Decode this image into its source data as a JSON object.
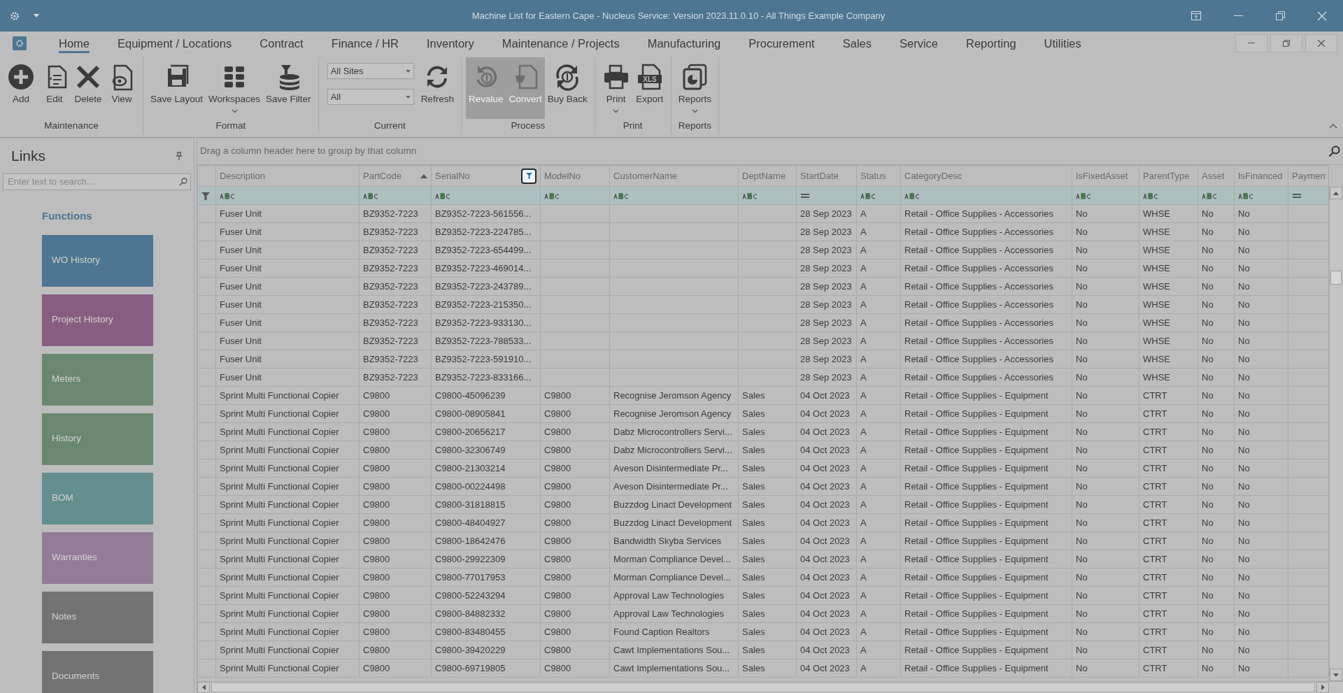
{
  "window": {
    "title": "Machine List for Eastern Cape - Nucleus Service: Version 2023.11.0.10 - All Things Example Company"
  },
  "menu_tabs": [
    {
      "label": "Home",
      "selected": true
    },
    {
      "label": "Equipment / Locations",
      "selected": false
    },
    {
      "label": "Contract",
      "selected": false
    },
    {
      "label": "Finance / HR",
      "selected": false
    },
    {
      "label": "Inventory",
      "selected": false
    },
    {
      "label": "Maintenance / Projects",
      "selected": false
    },
    {
      "label": "Manufacturing",
      "selected": false
    },
    {
      "label": "Procurement",
      "selected": false
    },
    {
      "label": "Sales",
      "selected": false
    },
    {
      "label": "Service",
      "selected": false
    },
    {
      "label": "Reporting",
      "selected": false
    },
    {
      "label": "Utilities",
      "selected": false
    }
  ],
  "ribbon_groups": [
    {
      "label": "Maintenance",
      "items": [
        {
          "kind": "button",
          "label": "Add",
          "disabled": false
        },
        {
          "kind": "button",
          "label": "Edit",
          "disabled": false
        },
        {
          "kind": "button",
          "label": "Delete",
          "disabled": false
        },
        {
          "kind": "button",
          "label": "View",
          "disabled": false
        }
      ]
    },
    {
      "label": "Format",
      "items": [
        {
          "kind": "button",
          "label": "Save Layout",
          "disabled": false
        },
        {
          "kind": "button",
          "label": "Workspaces",
          "disabled": false,
          "menu": true
        },
        {
          "kind": "button",
          "label": "Save Filter",
          "disabled": false
        }
      ]
    },
    {
      "label": "Current",
      "items": [
        {
          "kind": "dropdowns",
          "values": [
            "All Sites",
            "All"
          ]
        },
        {
          "kind": "button",
          "label": "Refresh",
          "disabled": false
        }
      ]
    },
    {
      "label": "Process",
      "items": [
        {
          "kind": "button",
          "label": "Revalue",
          "disabled": true
        },
        {
          "kind": "button",
          "label": "Convert",
          "disabled": true
        },
        {
          "kind": "button",
          "label": "Buy Back",
          "disabled": false
        }
      ]
    },
    {
      "label": "Print",
      "items": [
        {
          "kind": "button",
          "label": "Print",
          "disabled": false,
          "menu": true
        },
        {
          "kind": "button",
          "label": "Export",
          "disabled": false,
          "icon_text": "XLS"
        }
      ]
    },
    {
      "label": "Reports",
      "items": [
        {
          "kind": "button",
          "label": "Reports",
          "disabled": false,
          "menu": true
        }
      ]
    }
  ],
  "links": {
    "title": "Links",
    "search": {
      "placeholder": "Enter text to search..."
    },
    "section": "Functions",
    "tiles": [
      {
        "label": "WO History",
        "color": "#4e7591"
      },
      {
        "label": "Project History",
        "color": "#875e82"
      },
      {
        "label": "Meters",
        "color": "#6a8870"
      },
      {
        "label": "History",
        "color": "#6a8870"
      },
      {
        "label": "BOM",
        "color": "#658e8e"
      },
      {
        "label": "Warranties",
        "color": "#937c98"
      },
      {
        "label": "Notes",
        "color": "#737373"
      },
      {
        "label": "Documents",
        "color": "#737373"
      }
    ]
  },
  "grid": {
    "group_panel": "Drag a column header here to group by that column",
    "columns": [
      {
        "label": "Description"
      },
      {
        "label": "PartCode",
        "sorted_ascending": true
      },
      {
        "label": "SerialNo",
        "filter_button": true
      },
      {
        "label": "ModelNo"
      },
      {
        "label": "CustomerName"
      },
      {
        "label": "DeptName"
      },
      {
        "label": "StartDate"
      },
      {
        "label": "Status"
      },
      {
        "label": "CategoryDesc"
      },
      {
        "label": "IsFixedAsset"
      },
      {
        "label": "ParentType"
      },
      {
        "label": "Asset"
      },
      {
        "label": "IsFinanced"
      },
      {
        "label": "Paymen"
      }
    ],
    "filter_row": [
      {
        "kind": "text"
      },
      {
        "kind": "text"
      },
      {
        "kind": "text"
      },
      {
        "kind": "text"
      },
      {
        "kind": "text"
      },
      {
        "kind": "text"
      },
      {
        "kind": "equals"
      },
      {
        "kind": "text"
      },
      {
        "kind": "text"
      },
      {
        "kind": "text"
      },
      {
        "kind": "text"
      },
      {
        "kind": "text"
      },
      {
        "kind": "text"
      },
      {
        "kind": "equals"
      }
    ],
    "rows": [
      [
        "Fuser Unit",
        "BZ9352-7223",
        "BZ9352-7223-561556...",
        "",
        "",
        "",
        "28 Sep 2023",
        "A",
        "Retail - Office Supplies - Accessories",
        "No",
        "WHSE",
        "No",
        "No"
      ],
      [
        "Fuser Unit",
        "BZ9352-7223",
        "BZ9352-7223-224785...",
        "",
        "",
        "",
        "28 Sep 2023",
        "A",
        "Retail - Office Supplies - Accessories",
        "No",
        "WHSE",
        "No",
        "No"
      ],
      [
        "Fuser Unit",
        "BZ9352-7223",
        "BZ9352-7223-654499...",
        "",
        "",
        "",
        "28 Sep 2023",
        "A",
        "Retail - Office Supplies - Accessories",
        "No",
        "WHSE",
        "No",
        "No"
      ],
      [
        "Fuser Unit",
        "BZ9352-7223",
        "BZ9352-7223-469014...",
        "",
        "",
        "",
        "28 Sep 2023",
        "A",
        "Retail - Office Supplies - Accessories",
        "No",
        "WHSE",
        "No",
        "No"
      ],
      [
        "Fuser Unit",
        "BZ9352-7223",
        "BZ9352-7223-243789...",
        "",
        "",
        "",
        "28 Sep 2023",
        "A",
        "Retail - Office Supplies - Accessories",
        "No",
        "WHSE",
        "No",
        "No"
      ],
      [
        "Fuser Unit",
        "BZ9352-7223",
        "BZ9352-7223-215350...",
        "",
        "",
        "",
        "28 Sep 2023",
        "A",
        "Retail - Office Supplies - Accessories",
        "No",
        "WHSE",
        "No",
        "No"
      ],
      [
        "Fuser Unit",
        "BZ9352-7223",
        "BZ9352-7223-933130...",
        "",
        "",
        "",
        "28 Sep 2023",
        "A",
        "Retail - Office Supplies - Accessories",
        "No",
        "WHSE",
        "No",
        "No"
      ],
      [
        "Fuser Unit",
        "BZ9352-7223",
        "BZ9352-7223-788533...",
        "",
        "",
        "",
        "28 Sep 2023",
        "A",
        "Retail - Office Supplies - Accessories",
        "No",
        "WHSE",
        "No",
        "No"
      ],
      [
        "Fuser Unit",
        "BZ9352-7223",
        "BZ9352-7223-591910...",
        "",
        "",
        "",
        "28 Sep 2023",
        "A",
        "Retail - Office Supplies - Accessories",
        "No",
        "WHSE",
        "No",
        "No"
      ],
      [
        "Fuser Unit",
        "BZ9352-7223",
        "BZ9352-7223-833166...",
        "",
        "",
        "",
        "28 Sep 2023",
        "A",
        "Retail - Office Supplies - Accessories",
        "No",
        "WHSE",
        "No",
        "No"
      ],
      [
        "Sprint Multi Functional Copier",
        "C9800",
        "C9800-45096239",
        "C9800",
        "Recognise Jeromson Agency",
        "Sales",
        "04 Oct 2023",
        "A",
        "Retail - Office Supplies - Equipment",
        "No",
        "CTRT",
        "No",
        "No"
      ],
      [
        "Sprint Multi Functional Copier",
        "C9800",
        "C9800-08905841",
        "C9800",
        "Recognise Jeromson Agency",
        "Sales",
        "04 Oct 2023",
        "A",
        "Retail - Office Supplies - Equipment",
        "No",
        "CTRT",
        "No",
        "No"
      ],
      [
        "Sprint Multi Functional Copier",
        "C9800",
        "C9800-20656217",
        "C9800",
        "Dabz Microcontrollers Servi...",
        "Sales",
        "04 Oct 2023",
        "A",
        "Retail - Office Supplies - Equipment",
        "No",
        "CTRT",
        "No",
        "No"
      ],
      [
        "Sprint Multi Functional Copier",
        "C9800",
        "C9800-32306749",
        "C9800",
        "Dabz Microcontrollers Servi...",
        "Sales",
        "04 Oct 2023",
        "A",
        "Retail - Office Supplies - Equipment",
        "No",
        "CTRT",
        "No",
        "No"
      ],
      [
        "Sprint Multi Functional Copier",
        "C9800",
        "C9800-21303214",
        "C9800",
        "Aveson Disintermediate Pr...",
        "Sales",
        "04 Oct 2023",
        "A",
        "Retail - Office Supplies - Equipment",
        "No",
        "CTRT",
        "No",
        "No"
      ],
      [
        "Sprint Multi Functional Copier",
        "C9800",
        "C9800-00224498",
        "C9800",
        "Aveson Disintermediate Pr...",
        "Sales",
        "04 Oct 2023",
        "A",
        "Retail - Office Supplies - Equipment",
        "No",
        "CTRT",
        "No",
        "No"
      ],
      [
        "Sprint Multi Functional Copier",
        "C9800",
        "C9800-31818815",
        "C9800",
        "Buzzdog Linact Development",
        "Sales",
        "04 Oct 2023",
        "A",
        "Retail - Office Supplies - Equipment",
        "No",
        "CTRT",
        "No",
        "No"
      ],
      [
        "Sprint Multi Functional Copier",
        "C9800",
        "C9800-48404927",
        "C9800",
        "Buzzdog Linact Development",
        "Sales",
        "04 Oct 2023",
        "A",
        "Retail - Office Supplies - Equipment",
        "No",
        "CTRT",
        "No",
        "No"
      ],
      [
        "Sprint Multi Functional Copier",
        "C9800",
        "C9800-18642476",
        "C9800",
        "Bandwidth Skyba Services",
        "Sales",
        "04 Oct 2023",
        "A",
        "Retail - Office Supplies - Equipment",
        "No",
        "CTRT",
        "No",
        "No"
      ],
      [
        "Sprint Multi Functional Copier",
        "C9800",
        "C9800-29922309",
        "C9800",
        "Morman Compliance Devel...",
        "Sales",
        "04 Oct 2023",
        "A",
        "Retail - Office Supplies - Equipment",
        "No",
        "CTRT",
        "No",
        "No"
      ],
      [
        "Sprint Multi Functional Copier",
        "C9800",
        "C9800-77017953",
        "C9800",
        "Morman Compliance Devel...",
        "Sales",
        "04 Oct 2023",
        "A",
        "Retail - Office Supplies - Equipment",
        "No",
        "CTRT",
        "No",
        "No"
      ],
      [
        "Sprint Multi Functional Copier",
        "C9800",
        "C9800-52243294",
        "C9800",
        "Approval Law Technologies",
        "Sales",
        "04 Oct 2023",
        "A",
        "Retail - Office Supplies - Equipment",
        "No",
        "CTRT",
        "No",
        "No"
      ],
      [
        "Sprint Multi Functional Copier",
        "C9800",
        "C9800-84882332",
        "C9800",
        "Approval Law Technologies",
        "Sales",
        "04 Oct 2023",
        "A",
        "Retail - Office Supplies - Equipment",
        "No",
        "CTRT",
        "No",
        "No"
      ],
      [
        "Sprint Multi Functional Copier",
        "C9800",
        "C9800-83480455",
        "C9800",
        "Found Caption Realtors",
        "Sales",
        "04 Oct 2023",
        "A",
        "Retail - Office Supplies - Equipment",
        "No",
        "CTRT",
        "No",
        "No"
      ],
      [
        "Sprint Multi Functional Copier",
        "C9800",
        "C9800-39420229",
        "C9800",
        "Cawt Implementations Sou...",
        "Sales",
        "04 Oct 2023",
        "A",
        "Retail - Office Supplies - Equipment",
        "No",
        "CTRT",
        "No",
        "No"
      ],
      [
        "Sprint Multi Functional Copier",
        "C9800",
        "C9800-69719805",
        "C9800",
        "Cawt Implementations Sou...",
        "Sales",
        "04 Oct 2023",
        "A",
        "Retail - Office Supplies - Equipment",
        "No",
        "CTRT",
        "No",
        "No"
      ]
    ]
  }
}
